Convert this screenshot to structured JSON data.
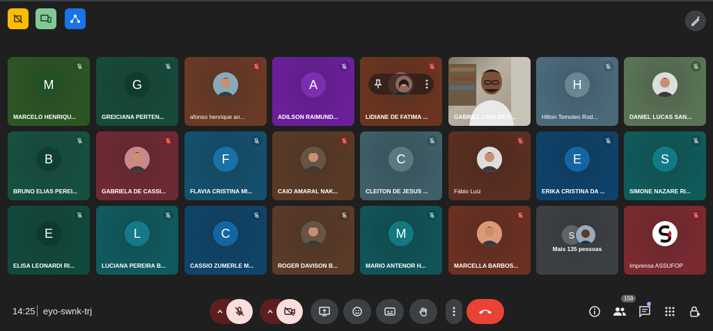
{
  "top_left_extensions": [
    {
      "name": "ext-yellow",
      "color": "#fbbc04",
      "icon": "no-video-icon"
    },
    {
      "name": "ext-green",
      "color": "#81c995",
      "icon": "device-icon"
    },
    {
      "name": "ext-blue",
      "color": "#1a73e8",
      "icon": "network-icon"
    }
  ],
  "top_right": {
    "icon": "pen-sparkle-icon"
  },
  "participants": [
    {
      "name": "MARCELO HENRIQU...",
      "initial": "M",
      "bg": "#2c5524",
      "av": "#215025",
      "mute_bg": "#2a4d25",
      "bold": true
    },
    {
      "name": "GREICIANA PERTEN...",
      "initial": "G",
      "bg": "#164a3a",
      "av": "#0e3d30",
      "mute_bg": "#17443a",
      "bold": true
    },
    {
      "name": "afonso henrique an...",
      "initial": "",
      "bg": "#6a3a26",
      "av": "#8ab",
      "photo": true,
      "mute_bg": "#7a2a22",
      "mute_red": true,
      "bold": false
    },
    {
      "name": "ADILSON RAIMUND...",
      "initial": "A",
      "bg": "#6b1f9a",
      "av": "#7b2fb0",
      "mute_bg": "#5a1a85",
      "bold": true
    },
    {
      "name": "LIDIANE DE FATIMA ...",
      "initial": "",
      "bg": "#6a3520",
      "av": "#a66",
      "photo": true,
      "mute_bg": "#7a2a22",
      "mute_red": true,
      "bold": true,
      "hover": true
    },
    {
      "name": "GABRIEL LIMA DE S...",
      "initial": "",
      "bg": "#9c8d7a",
      "video": true,
      "bold": true
    },
    {
      "name": "Hilton Temoteo Rod...",
      "initial": "H",
      "bg": "#4a6a7a",
      "av": "#6a8694",
      "mute_bg": "#3e5a69",
      "bold": false
    },
    {
      "name": "DANIEL LUCAS SAN...",
      "initial": "",
      "bg": "#5a7356",
      "av": "#ddd",
      "photo": true,
      "mute_bg": "#3b5a3a",
      "bold": true
    },
    {
      "name": "BRUNO ELIAS PEREI...",
      "initial": "B",
      "bg": "#165040",
      "av": "#0e3f33",
      "mute_bg": "#164739",
      "bold": true
    },
    {
      "name": "GABRIELA DE CASSI...",
      "initial": "",
      "bg": "#6e2a34",
      "av": "#c88",
      "photo": true,
      "mute_bg": "#7a2026",
      "mute_red": true,
      "bold": true
    },
    {
      "name": "FLAVIA CRISTINA MI...",
      "initial": "F",
      "bg": "#13506e",
      "av": "#1a6fa3",
      "mute_bg": "#114560",
      "bold": true
    },
    {
      "name": "CAIO AMARAL NAK...",
      "initial": "",
      "bg": "#5a3a26",
      "av": "#654",
      "photo": true,
      "mute_bg": "#6e2a22",
      "mute_red": true,
      "bold": true
    },
    {
      "name": "CLEITON DE JESUS ...",
      "initial": "C",
      "bg": "#3e5e68",
      "av": "#5b7781",
      "mute_bg": "#34525c",
      "bold": true
    },
    {
      "name": "Fábio Luiz",
      "initial": "",
      "bg": "#5a2e20",
      "av": "#ddd",
      "photo": true,
      "mute_bg": "#6e2a22",
      "mute_red": true,
      "bold": false
    },
    {
      "name": "ERIKA CRISTINA DA ...",
      "initial": "E",
      "bg": "#0e426a",
      "av": "#1565a3",
      "mute_bg": "#0e3a5c",
      "bold": true
    },
    {
      "name": "SIMONE NAZARE RI...",
      "initial": "S",
      "bg": "#0f5a5a",
      "av": "#127a84",
      "mute_bg": "#0e4c4e",
      "bold": true
    },
    {
      "name": "ELISA LEONARDI RI...",
      "initial": "E",
      "bg": "#11493d",
      "av": "#0d3b31",
      "mute_bg": "#124236",
      "bold": true
    },
    {
      "name": "LUCIANA PEREIRA B...",
      "initial": "L",
      "bg": "#0f5a5e",
      "av": "#127b87",
      "mute_bg": "#0e4c50",
      "bold": true
    },
    {
      "name": "CASSIO ZUMERLE M...",
      "initial": "C",
      "bg": "#0f4468",
      "av": "#1465a3",
      "mute_bg": "#0e3a5b",
      "bold": true
    },
    {
      "name": "ROGER DAVISON B...",
      "initial": "",
      "bg": "#5a3a28",
      "av": "#654",
      "photo": true,
      "mute_bg": "#4e3224",
      "bold": true
    },
    {
      "name": "MARIO ANTENOR H...",
      "initial": "M",
      "bg": "#0f5458",
      "av": "#127981",
      "mute_bg": "#0e4a4d",
      "bold": true
    },
    {
      "name": "MARCELLA BARBOS...",
      "initial": "",
      "bg": "#6a3022",
      "av": "#d97",
      "photo": true,
      "mute_bg": "#6e2a22",
      "mute_red": true,
      "bold": true
    },
    {
      "name": "Mais 135 pessoas",
      "initial": "S",
      "bg": "#3c4043",
      "av": "#5f6368",
      "more": true,
      "bold": true
    },
    {
      "name": "Imprensa ASSUFOP",
      "initial": "",
      "bg": "#7a2a30",
      "av": "#fff",
      "logo": true,
      "mute_bg": "#7a2026",
      "mute_red": true,
      "bold": false
    }
  ],
  "bottom": {
    "time": "14:25",
    "separator": "|",
    "meeting_code": "eyo-swnk-trj",
    "participants_badge": "159"
  }
}
